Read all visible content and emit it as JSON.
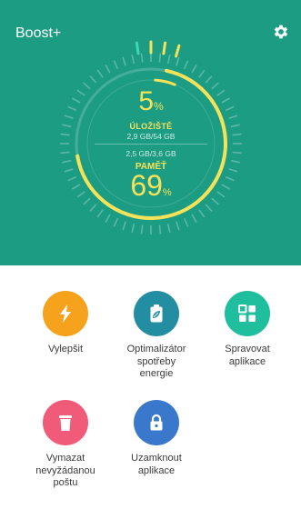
{
  "app": {
    "title": "Boost+"
  },
  "header": {
    "settings_icon": "gear-icon"
  },
  "storage": {
    "percent": "5",
    "unit": "%",
    "label": "ÚLOŽIŠTĚ",
    "detail": "2,9 GB/54 GB",
    "fill_fraction": 0.05
  },
  "memory": {
    "detail": "2,5 GB/3,6 GB",
    "label": "PAMĚŤ",
    "percent": "69",
    "unit": "%",
    "fill_fraction": 0.69
  },
  "colors": {
    "header_bg": "#1d9c84",
    "accent_yellow": "#f4e35a"
  },
  "tiles": [
    {
      "label": "Vylepšit",
      "icon": "bolt-icon",
      "color": "#f6a21d"
    },
    {
      "label": "Optimalizátor\nspotřeby\nenergie",
      "icon": "battery-leaf-icon",
      "color": "#238ea1"
    },
    {
      "label": "Spravovat\naplikace",
      "icon": "grid-apps-icon",
      "color": "#1fbf9e"
    },
    {
      "label": "Vymazat\nnevyžádanou\npoštu",
      "icon": "trash-icon",
      "color": "#ef5b78"
    },
    {
      "label": "Uzamknout\naplikace",
      "icon": "lock-icon",
      "color": "#3a78cc"
    }
  ]
}
